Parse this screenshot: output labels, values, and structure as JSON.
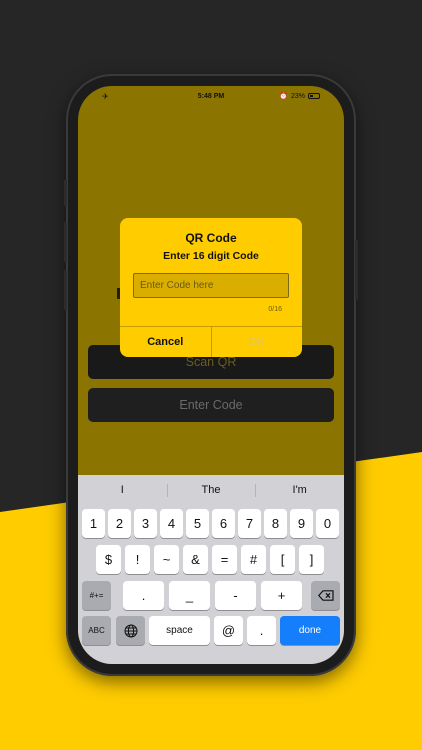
{
  "status_bar": {
    "time": "5:48 PM",
    "battery": "23%"
  },
  "app": {
    "scan_qr_label": "Scan QR",
    "enter_code_label": "Enter Code"
  },
  "dialog": {
    "title": "QR Code",
    "subtitle": "Enter 16 digit Code",
    "input_placeholder": "Enter Code here",
    "input_value": "",
    "counter": "0/16",
    "cancel_label": "Cancel",
    "ok_label": "OK"
  },
  "keyboard": {
    "suggestions": [
      "I",
      "The",
      "I'm"
    ],
    "row1": [
      "1",
      "2",
      "3",
      "4",
      "5",
      "6",
      "7",
      "8",
      "9",
      "0"
    ],
    "row2": [
      "$",
      "!",
      "~",
      "&",
      "=",
      "#",
      "[",
      "]"
    ],
    "row3_toggle": "#+=",
    "row3": [
      ".",
      "_",
      "-",
      "+"
    ],
    "abc_label": "ABC",
    "space_label": "space",
    "at_label": "@",
    "dot_label": ".",
    "done_label": "done"
  },
  "colors": {
    "accent_yellow": "#ffcc00",
    "keyboard_blue": "#147efb",
    "dark_bg": "#262626"
  }
}
